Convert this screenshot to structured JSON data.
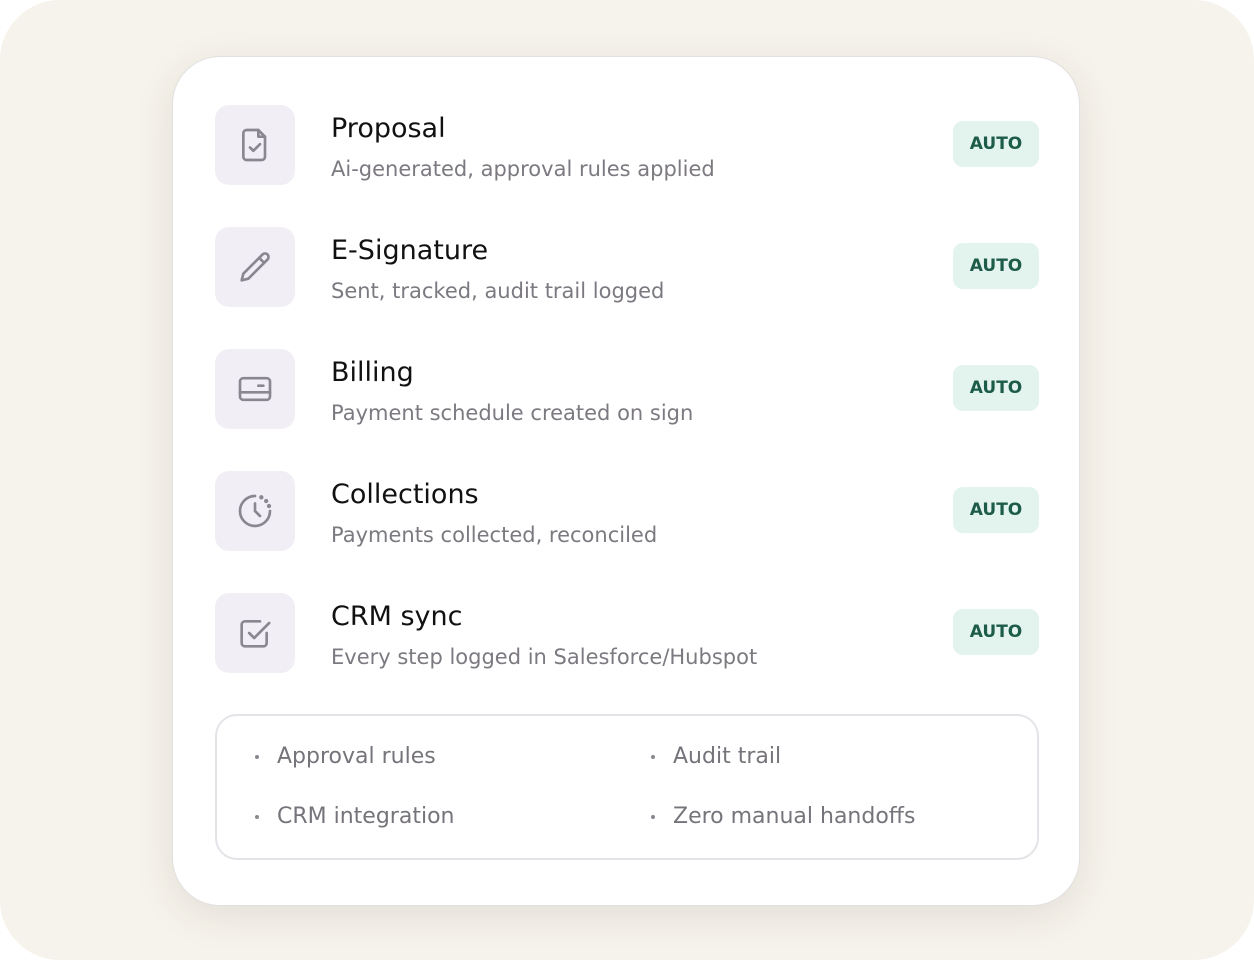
{
  "steps": [
    {
      "title": "Proposal",
      "description": "Ai-generated, approval rules applied",
      "badge": "AUTO",
      "icon": "document-check-icon"
    },
    {
      "title": "E-Signature",
      "description": "Sent, tracked, audit trail logged",
      "badge": "AUTO",
      "icon": "pencil-icon"
    },
    {
      "title": "Billing",
      "description": "Payment schedule created on sign",
      "badge": "AUTO",
      "icon": "credit-card-icon"
    },
    {
      "title": "Collections",
      "description": "Payments collected, reconciled",
      "badge": "AUTO",
      "icon": "clock-icon"
    },
    {
      "title": "CRM sync",
      "description": "Every step logged in Salesforce/Hubspot",
      "badge": "AUTO",
      "icon": "checkbox-icon"
    }
  ],
  "features": [
    "Approval rules",
    "Audit trail",
    "CRM integration",
    "Zero manual handoffs"
  ],
  "colors": {
    "badge_bg": "#e3f3ee",
    "badge_text": "#1c5c49",
    "icon_tile": "#f1eff5",
    "icon_stroke": "#8b8790",
    "backdrop": "#f6f3ec"
  }
}
